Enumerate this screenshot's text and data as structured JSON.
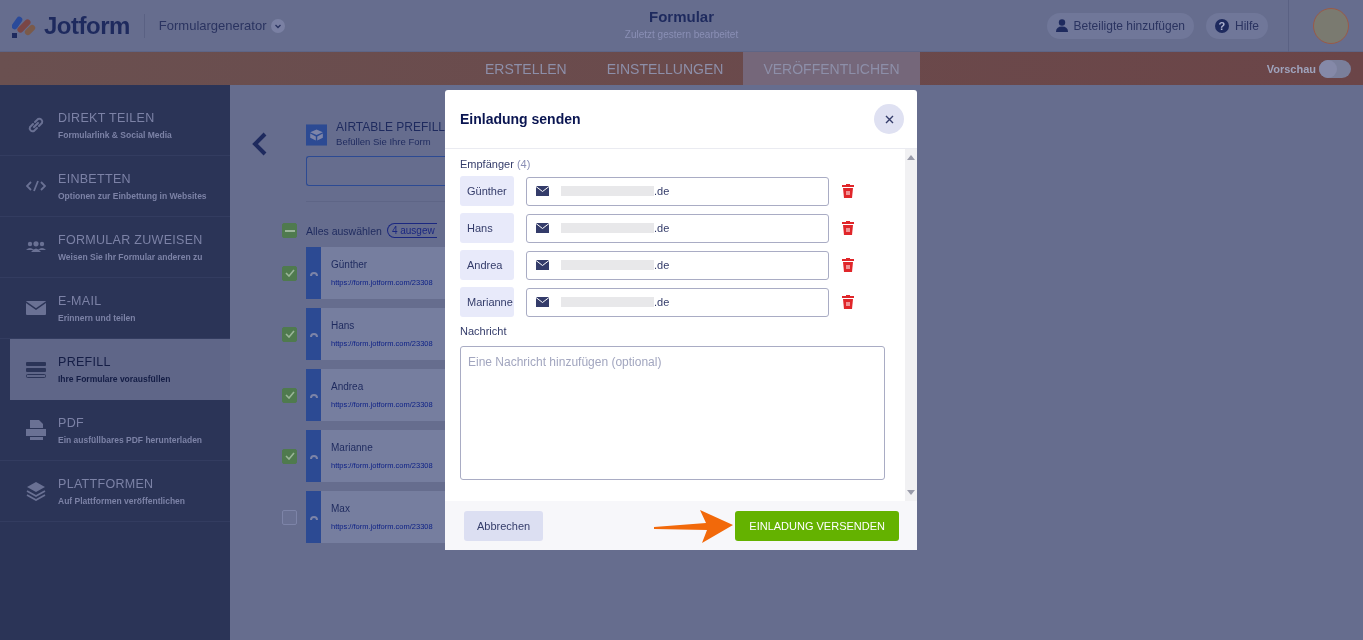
{
  "header": {
    "logo": "Jotform",
    "product": "Formulargenerator",
    "title": "Formular",
    "subtitle": "Zuletzt gestern bearbeitet",
    "buttons": [
      {
        "label": "Beteiligte hinzufügen",
        "kind": "person"
      },
      {
        "label": "Hilfe",
        "kind": "help",
        "icon": "?"
      }
    ]
  },
  "tabs": [
    {
      "label": "ERSTELLEN",
      "selected": false
    },
    {
      "label": "EINSTELLUNGEN",
      "selected": false
    },
    {
      "label": "VERÖFFENTLICHEN",
      "selected": true
    }
  ],
  "preview": {
    "label": "Vorschau",
    "on": false
  },
  "sidebar": {
    "items": [
      {
        "title": "DIREKT TEILEN",
        "subtitle": "Formularlink & Social Media",
        "kind": "link",
        "selected": false
      },
      {
        "title": "EINBETTEN",
        "subtitle": "Optionen zur Einbettung in Websites",
        "kind": "embed",
        "selected": false
      },
      {
        "title": "FORMULAR ZUWEISEN",
        "subtitle": "Weisen Sie Ihr Formular anderen zu",
        "kind": "people",
        "selected": false
      },
      {
        "title": "E-MAIL",
        "subtitle": "Erinnern und teilen",
        "kind": "mail",
        "selected": false
      },
      {
        "title": "PREFILL",
        "subtitle": "Ihre Formulare vorausfüllen",
        "kind": "prefill",
        "selected": true
      },
      {
        "title": "PDF",
        "subtitle": "Ein ausfüllbares PDF herunterladen",
        "kind": "pdf",
        "selected": false
      },
      {
        "title": "PLATTFORMEN",
        "subtitle": "Auf Plattformen veröffentlichen",
        "kind": "layers",
        "selected": false
      }
    ]
  },
  "prefill": {
    "title": "AIRTABLE PREFILL",
    "subtitle": "Befüllen Sie Ihre Form",
    "select_all": {
      "label": "Alles auswählen",
      "indeterminate": true
    },
    "selected_count": "4 ausgew",
    "entries": [
      {
        "name": "Günther",
        "url": "https://form.jotform.com/23308",
        "checked": true
      },
      {
        "name": "Hans",
        "url": "https://form.jotform.com/23308",
        "checked": true
      },
      {
        "name": "Andrea",
        "url": "https://form.jotform.com/23308",
        "checked": true
      },
      {
        "name": "Marianne",
        "url": "https://form.jotform.com/23308",
        "checked": true
      },
      {
        "name": "Max",
        "url": "https://form.jotform.com/23308",
        "checked": false
      }
    ]
  },
  "modal": {
    "title": "Einladung senden",
    "recipients_label": "Empfänger",
    "recipients_count": "(4)",
    "recipients": [
      {
        "name": "Günther",
        "email": ".de"
      },
      {
        "name": "Hans",
        "email": ".de"
      },
      {
        "name": "Andrea",
        "email": ".de"
      },
      {
        "name": "Marianne",
        "email": ".de"
      }
    ],
    "message_label": "Nachricht",
    "message_placeholder": "Eine Nachricht hinzufügen (optional)",
    "cancel": "Abbrechen",
    "submit": "EINLADUNG VERSENDEN"
  }
}
